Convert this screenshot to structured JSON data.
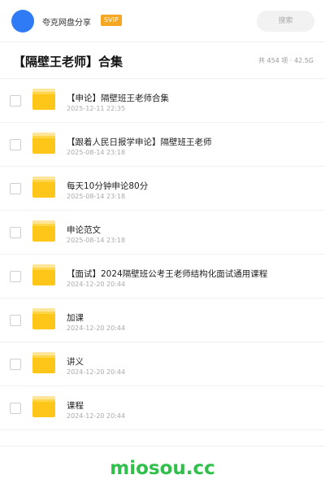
{
  "header": {
    "user_name": "夸克网盘分享",
    "badge": "SVIP",
    "search_label": "搜索"
  },
  "title_bar": {
    "title": "【隔壁王老师】合集",
    "summary": "共 454 项 · 42.5G"
  },
  "files": [
    {
      "name": "【申论】隔壁班王老师合集",
      "date": "2025-12-11 22:35",
      "icon": "folder-icon"
    },
    {
      "name": "【跟着人民日报学申论】隔壁班王老师",
      "date": "2025-08-14 23:18",
      "icon": "folder-icon"
    },
    {
      "name": "每天10分钟申论80分",
      "date": "2025-08-14 23:18",
      "icon": "folder-icon"
    },
    {
      "name": "申论范文",
      "date": "2025-08-14 23:18",
      "icon": "folder-icon"
    },
    {
      "name": "【面试】2024隔壁班公考王老师结构化面试通用课程",
      "date": "2024-12-20 20:44",
      "icon": "folder-icon"
    },
    {
      "name": "加课",
      "date": "2024-12-20 20:44",
      "icon": "folder-icon"
    },
    {
      "name": "讲义",
      "date": "2024-12-20 20:44",
      "icon": "folder-icon"
    },
    {
      "name": "课程",
      "date": "2024-12-20 20:44",
      "icon": "folder-icon"
    }
  ],
  "footer": {
    "watermark": "miosou.cc"
  },
  "colors": {
    "avatar": "#2f7bf5",
    "badge": "#f5a623",
    "folder": "#ffc61a",
    "watermark": "#2fbf4a"
  }
}
